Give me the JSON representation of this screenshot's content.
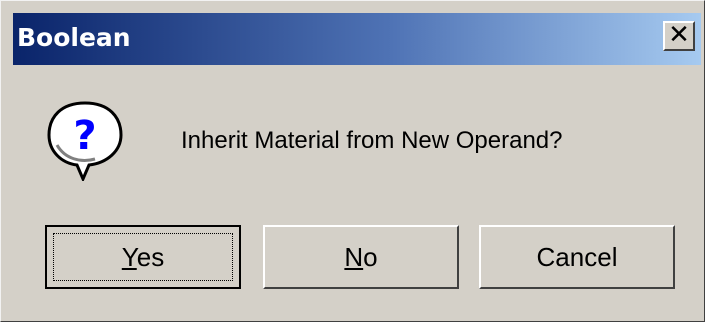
{
  "window": {
    "title": "Boolean",
    "close_glyph": "✕"
  },
  "message": {
    "text": "Inherit Material from New Operand?",
    "icon": "question-icon"
  },
  "buttons": {
    "yes": {
      "accel": "Y",
      "rest": "es"
    },
    "no": {
      "accel": "N",
      "rest": "o"
    },
    "cancel": {
      "label": "Cancel"
    }
  },
  "colors": {
    "title_start": "#0a246a",
    "title_end": "#a6caf0",
    "face": "#d4d0c8",
    "icon_question": "#0000ff"
  }
}
